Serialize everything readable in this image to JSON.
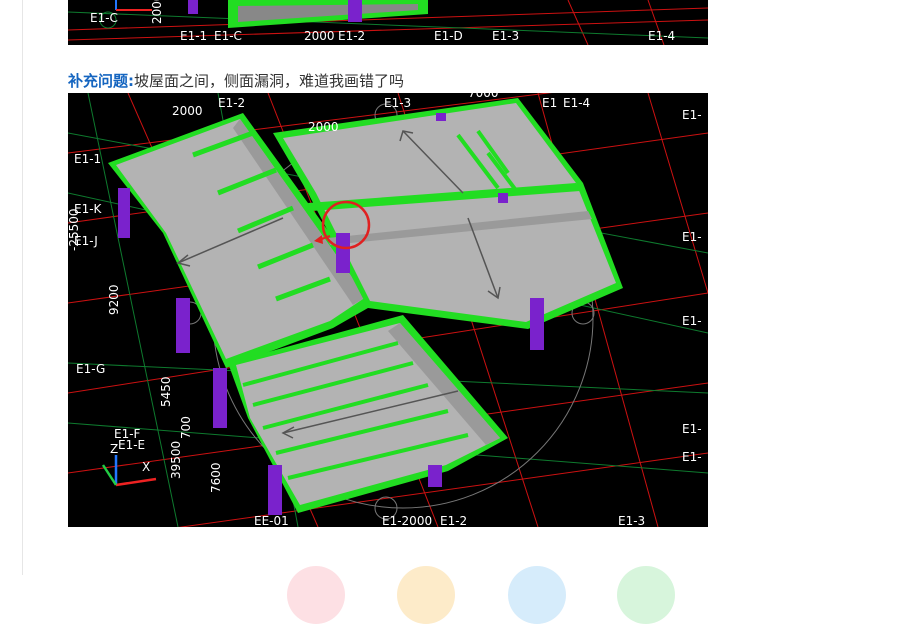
{
  "top_image": {
    "labels": [
      "E1-C",
      "2000",
      "E1-1",
      "E1-C",
      "2000",
      "E1-2",
      "E1-D",
      "E1-3",
      "E1-4"
    ]
  },
  "question": {
    "label": "补充问题:",
    "text": "坡屋面之间，侧面漏洞，难道我画错了吗"
  },
  "main_image": {
    "labels_top": [
      "2000",
      "E1-2",
      "2000",
      "E1-3",
      "7000",
      "E1",
      "E1-4"
    ],
    "labels_left": [
      "E1-1",
      "E1-K",
      "E1-J",
      "E1-G",
      "E1-F",
      "E1-E"
    ],
    "labels_right": [
      "E1-",
      "E1-",
      "E1-",
      "E1-",
      "E1-"
    ],
    "dims_vertical": [
      "-25500",
      "9200",
      "5450",
      "700",
      "39500",
      "7600"
    ],
    "labels_bottom": [
      "EE-01",
      "E1-2000",
      "E1-2",
      "E1-3"
    ],
    "axis_marks": [
      "Z",
      "X"
    ]
  },
  "colors": {
    "accent": "#1565c0",
    "roof": "#b3b3b3",
    "beam": "#22dd22",
    "column": "#7a22cc",
    "grid_red": "#cc1111",
    "grid_green": "#0e7a2e",
    "highlight": "#e02020"
  },
  "reactions": [
    {
      "icon": "reaction-pink-icon",
      "color": "#fde0e4"
    },
    {
      "icon": "reaction-yellow-icon",
      "color": "#fdebc9"
    },
    {
      "icon": "reaction-blue-icon",
      "color": "#d6ecfb"
    },
    {
      "icon": "reaction-green-icon",
      "color": "#d7f5dc"
    }
  ]
}
